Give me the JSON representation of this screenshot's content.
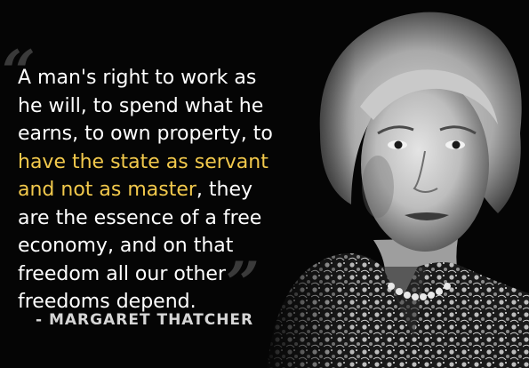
{
  "quote": {
    "open_mark": "“",
    "close_mark": "”",
    "highlight_color": "#f2c94c",
    "text_color": "#ffffff",
    "lines": [
      {
        "before": "A man's right to work as",
        "highlight": "",
        "after": ""
      },
      {
        "before": "he will, to spend what he",
        "highlight": "",
        "after": ""
      },
      {
        "before": "earns, to own property, to",
        "highlight": "",
        "after": ""
      },
      {
        "before": "",
        "highlight": "have the state as servant",
        "after": ""
      },
      {
        "before": "",
        "highlight": "and not as master",
        "after": ", they"
      },
      {
        "before": "are the essence of a free",
        "highlight": "",
        "after": ""
      },
      {
        "before": "economy, and on that",
        "highlight": "",
        "after": ""
      },
      {
        "before": "freedom all our other",
        "highlight": "",
        "after": ""
      },
      {
        "before": "freedoms depend.",
        "highlight": "",
        "after": ""
      }
    ]
  },
  "attribution": "- MARGARET THATCHER",
  "portrait": {
    "icon": "portrait-photo-icon",
    "background_color": "#050505"
  }
}
